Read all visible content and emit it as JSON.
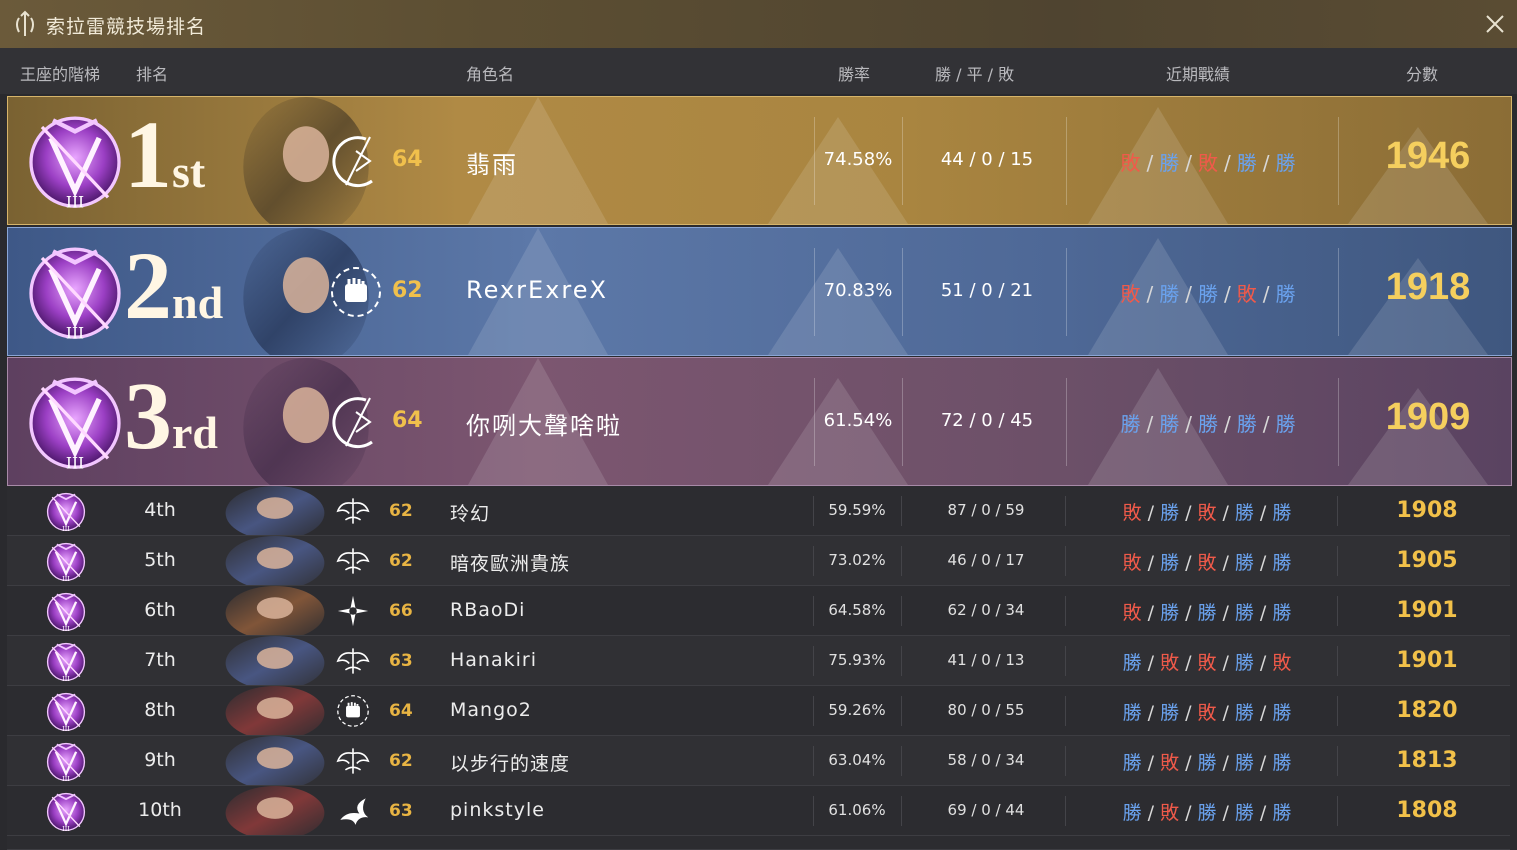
{
  "window": {
    "title": "索拉雷競技場排名"
  },
  "columns": {
    "tier": "王座的階梯",
    "rank": "排名",
    "name": "角色名",
    "winrate": "勝率",
    "wdl": "勝 / 平 / 敗",
    "recent": "近期戰績",
    "score": "分數"
  },
  "top": [
    {
      "rank_num": "1",
      "rank_sfx": "st",
      "level": "64",
      "name": "翡雨",
      "winrate": "74.58%",
      "wdl": "44 / 0 / 15",
      "recent": [
        "敗",
        "勝",
        "敗",
        "勝",
        "勝"
      ],
      "score": "1946",
      "class_icon": "crescent-blade-icon"
    },
    {
      "rank_num": "2",
      "rank_sfx": "nd",
      "level": "62",
      "name": "RexrExreX",
      "winrate": "70.83%",
      "wdl": "51 / 0 / 21",
      "recent": [
        "敗",
        "勝",
        "勝",
        "敗",
        "勝"
      ],
      "score": "1918",
      "class_icon": "fist-icon"
    },
    {
      "rank_num": "3",
      "rank_sfx": "rd",
      "level": "64",
      "name": "你咧大聲啥啦",
      "winrate": "61.54%",
      "wdl": "72 / 0 / 45",
      "recent": [
        "勝",
        "勝",
        "勝",
        "勝",
        "勝"
      ],
      "score": "1909",
      "class_icon": "crescent-blade-icon"
    }
  ],
  "rows": [
    {
      "rank": "4th",
      "level": "62",
      "name": "玲幻",
      "winrate": "59.59%",
      "wdl": "87 / 0 / 59",
      "recent": [
        "敗",
        "勝",
        "敗",
        "勝",
        "勝"
      ],
      "score": "1908",
      "class_icon": "winged-emblem-icon"
    },
    {
      "rank": "5th",
      "level": "62",
      "name": "暗夜歐洲貴族",
      "winrate": "73.02%",
      "wdl": "46 / 0 / 17",
      "recent": [
        "敗",
        "勝",
        "敗",
        "勝",
        "勝"
      ],
      "score": "1905",
      "class_icon": "winged-emblem-icon"
    },
    {
      "rank": "6th",
      "level": "66",
      "name": "RBaoDi",
      "winrate": "64.58%",
      "wdl": "62 / 0 / 34",
      "recent": [
        "敗",
        "勝",
        "勝",
        "勝",
        "勝"
      ],
      "score": "1901",
      "class_icon": "star-blade-icon"
    },
    {
      "rank": "7th",
      "level": "63",
      "name": "Hanakiri",
      "winrate": "75.93%",
      "wdl": "41 / 0 / 13",
      "recent": [
        "勝",
        "敗",
        "敗",
        "勝",
        "敗"
      ],
      "score": "1901",
      "class_icon": "winged-emblem-icon"
    },
    {
      "rank": "8th",
      "level": "64",
      "name": "Mango2",
      "winrate": "59.26%",
      "wdl": "80 / 0 / 55",
      "recent": [
        "勝",
        "勝",
        "敗",
        "勝",
        "勝"
      ],
      "score": "1820",
      "class_icon": "fist-icon"
    },
    {
      "rank": "9th",
      "level": "62",
      "name": "以步行的速度",
      "winrate": "63.04%",
      "wdl": "58 / 0 / 34",
      "recent": [
        "勝",
        "敗",
        "勝",
        "勝",
        "勝"
      ],
      "score": "1813",
      "class_icon": "winged-emblem-icon"
    },
    {
      "rank": "10th",
      "level": "63",
      "name": "pinkstyle",
      "winrate": "61.06%",
      "wdl": "69 / 0 / 44",
      "recent": [
        "勝",
        "敗",
        "勝",
        "勝",
        "勝"
      ],
      "score": "1808",
      "class_icon": "wind-swirl-icon"
    }
  ],
  "colors": {
    "win": "#6aa2ee",
    "loss": "#f05a4a",
    "score": "#f2c149",
    "level": "#e8b443"
  }
}
